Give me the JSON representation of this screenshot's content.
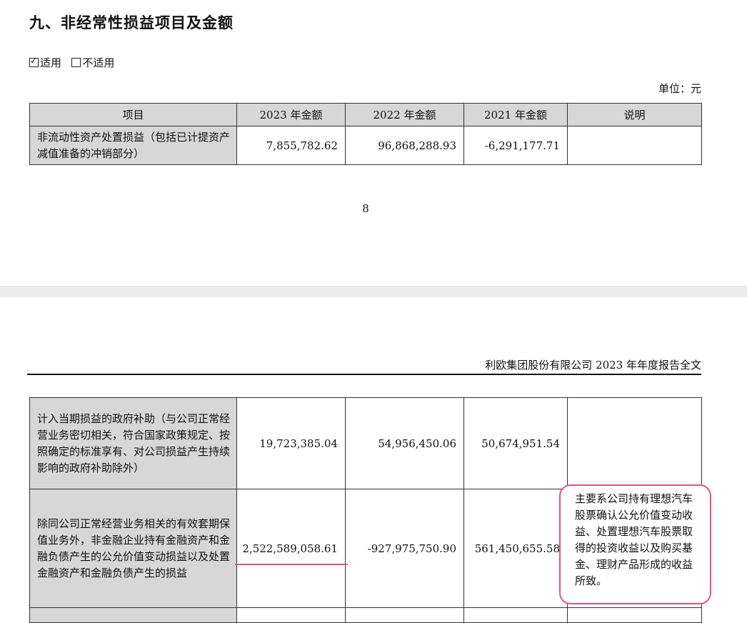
{
  "section": {
    "title": "九、非经常性损益项目及金额",
    "applicable_label": "适用",
    "not_applicable_label": "不适用",
    "unit": "单位：元"
  },
  "table": {
    "headers": [
      "项目",
      "2023 年金额",
      "2022 年金额",
      "2021 年金额",
      "说明"
    ],
    "rows": [
      {
        "item": "非流动性资产处置损益（包括已计提资产减值准备的冲销部分）",
        "v2023": "7,855,782.62",
        "v2022": "96,868,288.93",
        "v2021": "-6,291,177.71",
        "note": ""
      },
      {
        "item": "计入当期损益的政府补助（与公司正常经营业务密切相关，符合国家政策规定、按照确定的标准享有、对公司损益产生持续影响的政府补助除外）",
        "v2023": "19,723,385.04",
        "v2022": "54,956,450.06",
        "v2021": "50,674,951.54",
        "note": ""
      },
      {
        "item": "除同公司正常经营业务相关的有效套期保值业务外，非金融企业持有金融资产和金融负债产生的公允价值变动损益以及处置金融资产和金融负债产生的损益",
        "v2023": "2,522,589,058.61",
        "v2022": "-927,975,750.90",
        "v2021": "561,450,655.58",
        "note": "主要系公司持有理想汽车股票确认公允价值变动收益、处置理想汽车股票取得的投资收益以及购买基金、理财产品形成的收益所致。"
      }
    ]
  },
  "page_number": "8",
  "report_header": "利欧集团股份有限公司 2023 年年度报告全文"
}
